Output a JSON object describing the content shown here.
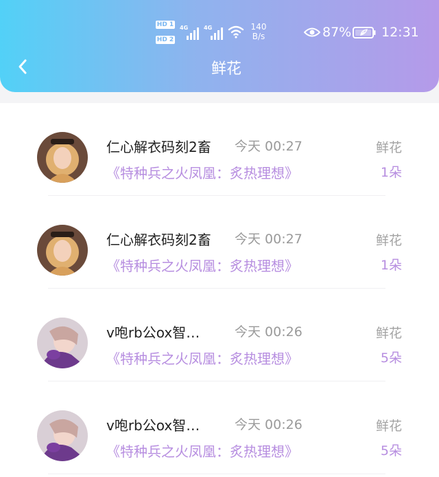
{
  "status_bar": {
    "sim1": "HD 1",
    "sim2": "HD 2",
    "network": "4G",
    "speed_value": "140",
    "speed_unit": "B/s",
    "battery": "87%",
    "time": "12:31"
  },
  "header": {
    "title": "鲜花"
  },
  "items": [
    {
      "name": "仁心解衣码刻2畜",
      "time": "今天 00:27",
      "book": "《特种兵之火凤凰：炙热理想》",
      "gift": "鲜花",
      "count": "1朵",
      "avatar": "blonde"
    },
    {
      "name": "仁心解衣码刻2畜",
      "time": "今天 00:27",
      "book": "《特种兵之火凤凰：炙热理想》",
      "gift": "鲜花",
      "count": "1朵",
      "avatar": "blonde"
    },
    {
      "name": "v咆rb公ox智…",
      "time": "今天 00:26",
      "book": "《特种兵之火凤凰：炙热理想》",
      "gift": "鲜花",
      "count": "5朵",
      "avatar": "purple"
    },
    {
      "name": "v咆rb公ox智…",
      "time": "今天 00:26",
      "book": "《特种兵之火凤凰：炙热理想》",
      "gift": "鲜花",
      "count": "5朵",
      "avatar": "purple"
    }
  ],
  "colors": {
    "accent": "#b78ee0",
    "header_start": "#52d1f7",
    "header_end": "#b59ae9"
  }
}
